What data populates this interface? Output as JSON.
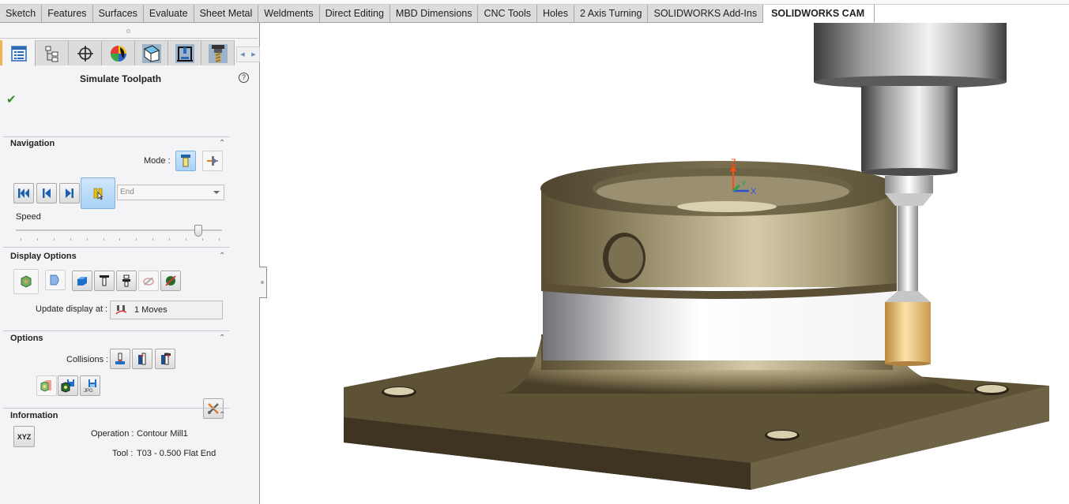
{
  "ribbon": {
    "tabs": [
      {
        "label": "Sketch",
        "active": false
      },
      {
        "label": "Features",
        "active": false
      },
      {
        "label": "Surfaces",
        "active": false
      },
      {
        "label": "Evaluate",
        "active": false
      },
      {
        "label": "Sheet Metal",
        "active": false
      },
      {
        "label": "Weldments",
        "active": false
      },
      {
        "label": "Direct Editing",
        "active": false
      },
      {
        "label": "MBD Dimensions",
        "active": false
      },
      {
        "label": "CNC Tools",
        "active": false
      },
      {
        "label": "Holes",
        "active": false
      },
      {
        "label": "2 Axis Turning",
        "active": false
      },
      {
        "label": "SOLIDWORKS Add-Ins",
        "active": false
      },
      {
        "label": "SOLIDWORKS CAM",
        "active": true
      }
    ]
  },
  "panel": {
    "icon_tabs": [
      "property-manager-icon",
      "configuration-manager-icon",
      "dimxpert-icon",
      "display-manager-icon",
      "cam-feature-tree-icon",
      "cam-operation-tree-icon",
      "cam-tool-tree-icon"
    ],
    "title": "Simulate Toolpath",
    "help_glyph": "?",
    "ok_glyph": "✔",
    "navigation": {
      "title": "Navigation",
      "mode_label": "Mode :",
      "step_dropdown": {
        "value": "End"
      },
      "speed_label": "Speed",
      "speed_value_fraction": 0.9
    },
    "display_options": {
      "title": "Display Options",
      "update_label": "Update display at :",
      "update_value": "1 Moves"
    },
    "options": {
      "title": "Options",
      "collisions_label": "Collisions :",
      "jpg_label": "JPG"
    },
    "information": {
      "title": "Information",
      "xyz_label": "XYZ",
      "operation_label": "Operation :",
      "operation_value": "Contour Mill1",
      "tool_label": "Tool :",
      "tool_value": "T03 - 0.500 Flat End"
    },
    "collapse_glyph": "⌃"
  },
  "viewport": {
    "triad": {
      "z": "Z",
      "y": "Y",
      "x": "X"
    },
    "colors": {
      "part_body": "#8a7f5c",
      "part_light": "#d8cfae",
      "part_dark": "#3b3220",
      "machined_band": "#f2f2f2",
      "tool_holder": "#c8c8c8",
      "cutter": "#e0b56a",
      "axis_z": "#ff4a12",
      "axis_y": "#25a346",
      "axis_x": "#2b50d8"
    }
  }
}
